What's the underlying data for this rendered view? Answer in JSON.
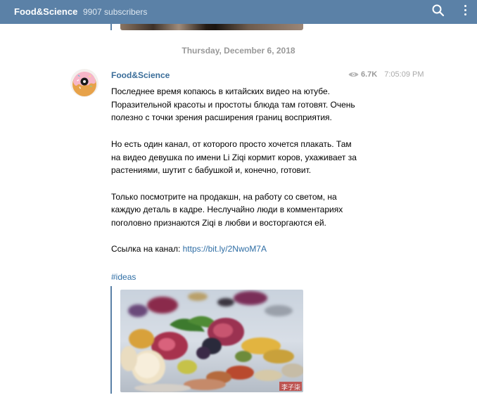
{
  "header": {
    "channel_name": "Food&Science",
    "subscribers": "9907 subscribers",
    "icons": [
      "search-icon",
      "more-vertical-icon"
    ],
    "background_color": "#5b81a7"
  },
  "date_separator": "Thursday, December 6, 2018",
  "message": {
    "author": "Food&Science",
    "views": "6.7K",
    "time": "7:05:09 PM",
    "paragraphs": [
      {
        "lines": [
          "Последнее время копаюсь в китайских видео на ютубе.",
          "Поразительной красоты и простоты блюда там готовят. Очень",
          "полезно с точки зрения расширения границ восприятия."
        ]
      },
      {
        "lines": [
          "Но есть один канал, от которого просто хочется плакать. Там",
          "на видео девушка по имени Li Ziqi кормит коров, ухаживает за",
          "растениями, шутит с бабушкой и, конечно, готовит."
        ]
      },
      {
        "lines": [
          "Только посмотрите на продакшн, на работу со светом, на",
          "каждую деталь в кадре. Неслучайно люди в комментариях",
          "поголовно признаются Ziqi в любви и восторгаются ей."
        ]
      }
    ],
    "link_prefix": "Ссылка на канал: ",
    "link": "https://bit.ly/2NwoM7A",
    "hashtag": "#ideas",
    "photo_watermark": "李子柒",
    "accent_color": "#3a6d99",
    "link_color": "#2f6ea5"
  }
}
